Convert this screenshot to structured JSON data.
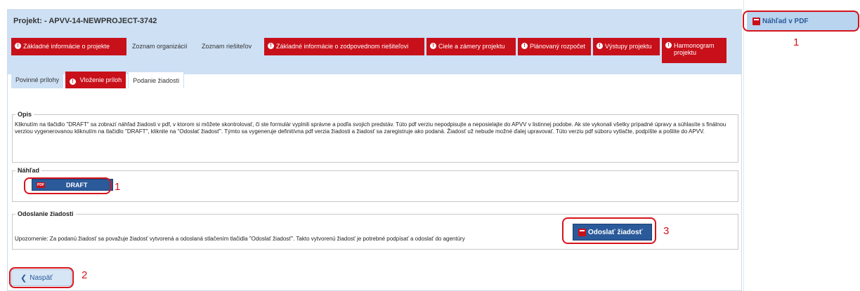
{
  "project": {
    "title": "Projekt:  - APVV-14-NEWPROJECT-3742"
  },
  "main_tabs": [
    {
      "label": "Základné informácie o projekte",
      "warning": true
    },
    {
      "label": "Zoznam organizácií",
      "warning": false
    },
    {
      "label": "Zoznam riešiteľov",
      "warning": false
    },
    {
      "label": "Základné informácie o zodpovednom riešiteľovi",
      "warning": true
    },
    {
      "label": "Ciele a zámery projektu",
      "warning": true
    },
    {
      "label": "Plánovaný rozpočet",
      "warning": true
    },
    {
      "label": "Výstupy projektu",
      "warning": true
    },
    {
      "label": "Harmonogram projektu",
      "warning": true
    }
  ],
  "sub_tabs": [
    {
      "label": "Povinné prílohy",
      "warning": false
    },
    {
      "label": "Vloženie príloh",
      "warning": true
    },
    {
      "label": "Podanie žiadosti",
      "warning": false,
      "active": true
    }
  ],
  "opis": {
    "legend": "Opis",
    "text": "Kliknutím na tlačidlo \"DRAFT\" sa zobrazí náhľad žiadosti v pdf, v ktorom si môžete skontrolovať, či ste formulár vyplnili správne a podľa svojich predstáv. Túto pdf verziu nepodpisujte a neposielajte do APVV v listinnej podobe. Ak ste vykonali všetky prípadné úpravy a súhlasíte s finálnou verziou vygenerovanou kliknutím na tlačidlo \"DRAFT\", kliknite na \"Odoslať žiadosť\". Týmto sa vygeneruje definitívna pdf verzia žiadosti a žiadosť sa zaregistruje ako podaná. Žiadosť už nebude možné ďalej upravovať. Túto verziu pdf súboru vytlačte, podpíšte a pošlite do APVV."
  },
  "nahlad": {
    "legend": "Náhľad",
    "draft_label": "DRAFT",
    "pdf_badge": "PDF"
  },
  "odoslanie": {
    "legend": "Odoslanie žiadosti",
    "warning_text": "Upozornenie: Za podanú žiadosť sa považuje žiadosť vytvorená a odoslaná stlačením tlačidla \"Odoslať žiadosť\". Takto vytvorenú žiadosť je potrebné podpísať a odoslať do agentúry",
    "send_label": "Odoslať žiadosť"
  },
  "back": {
    "label": "Naspäť"
  },
  "side": {
    "pdf_preview_label": "Náhľad v PDF"
  },
  "warning_glyph": "!",
  "annotations": [
    "1",
    "1",
    "2",
    "3"
  ],
  "colors": {
    "tab_red": "#c8101a",
    "header_blue": "#cde0f4",
    "button_blue": "#2b5a9a",
    "highlight_red": "#d6141c"
  }
}
